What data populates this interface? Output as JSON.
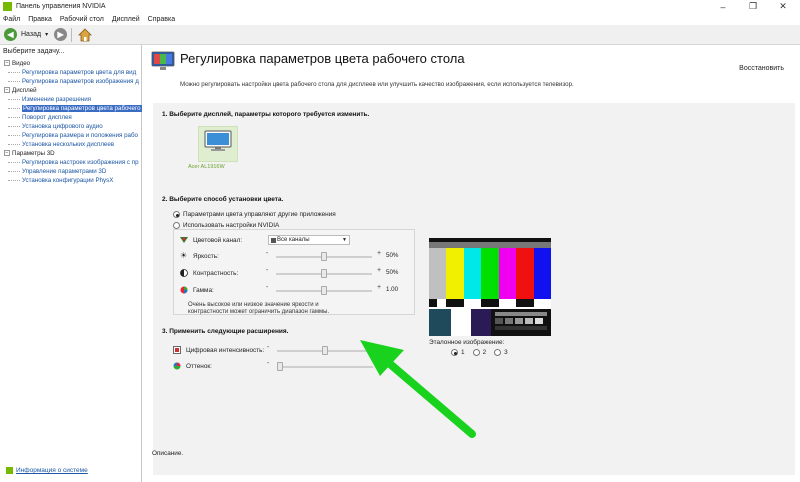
{
  "window": {
    "title": "Панель управления NVIDIA",
    "controls": [
      "–",
      "❐",
      "✕"
    ]
  },
  "menu": [
    "Файл",
    "Правка",
    "Рабочий стол",
    "Дисплей",
    "Справка"
  ],
  "toolbar": {
    "back_label": "Назад"
  },
  "sidebar": {
    "header": "Выберите задачу...",
    "tree": [
      {
        "label": "Видео",
        "type": "cat"
      },
      {
        "label": "Регулировка параметров цвета для вид",
        "type": "child"
      },
      {
        "label": "Регулировка параметров изображения д",
        "type": "child"
      },
      {
        "label": "Дисплей",
        "type": "cat"
      },
      {
        "label": "Изменение разрешения",
        "type": "child"
      },
      {
        "label": "Регулировка параметров цвета рабочего",
        "type": "child",
        "selected": true
      },
      {
        "label": "Поворот дисплея",
        "type": "child"
      },
      {
        "label": "Установка цифрового аудио",
        "type": "child"
      },
      {
        "label": "Регулировка размера и положения рабо",
        "type": "child"
      },
      {
        "label": "Установка нескольких дисплеев",
        "type": "child"
      },
      {
        "label": "Параметры 3D",
        "type": "cat"
      },
      {
        "label": "Регулировка настроек изображения с пр",
        "type": "child"
      },
      {
        "label": "Управление параметрами 3D",
        "type": "child"
      },
      {
        "label": "Установка конфигурации PhysX",
        "type": "child"
      }
    ],
    "footer_link": "Информация о системе"
  },
  "page": {
    "title": "Регулировка параметров цвета рабочего стола",
    "restore": "Восстановить",
    "description": "Можно регулировать настройки цвета рабочего стола для дисплеев или улучшить качество изображения, если используется телевизор.",
    "section1": "1. Выберите дисплей, параметры которого требуется изменить.",
    "display_name": "Acer AL1916W",
    "section2": "2. Выберите способ установки цвета.",
    "radio_other_apps": "Параметрами цвета управляют другие приложения",
    "radio_nvidia": "Использовать настройки NVIDIA",
    "color_channel_label": "Цветовой канал:",
    "color_channel_value": "Все каналы",
    "brightness": {
      "label": "Яркость:",
      "value": "50%",
      "level": 0.5
    },
    "contrast": {
      "label": "Контрастность:",
      "value": "50%",
      "level": 0.5
    },
    "gamma": {
      "label": "Гамма:",
      "value": "1.00",
      "level": 0.5
    },
    "warning": "Очень высокое или низкое значение яркости и контрастности может ограничить диапазон гаммы.",
    "section3": "3. Применить следующие расширения.",
    "digital_vibrance": {
      "label": "Цифровая интенсивность:",
      "level": 0.5
    },
    "hue": {
      "label": "Оттенок:",
      "level": 0.0
    },
    "reference_label": "Эталонное изображение:",
    "reference_options": [
      "1",
      "2",
      "3"
    ],
    "description_label": "Описание."
  },
  "colors": {
    "nvidia_green": "#76b900",
    "selection_blue": "#3b6cc4",
    "arrow_green": "#19d21e"
  }
}
